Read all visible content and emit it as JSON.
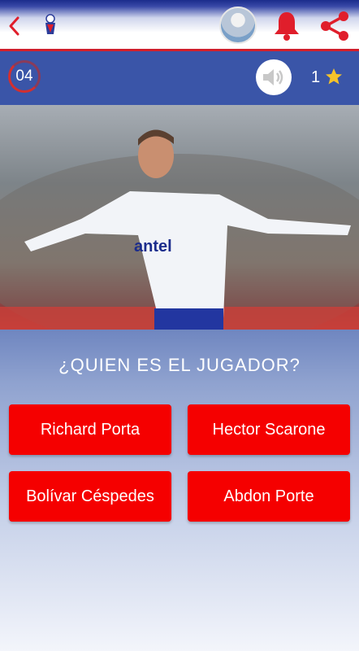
{
  "header": {
    "icons": [
      "back-chevron-icon",
      "team-logo-icon",
      "avatar",
      "bell-icon",
      "share-icon"
    ],
    "colors": {
      "accent_red": "#e01e2b",
      "bar_blue": "#3a55a8"
    }
  },
  "hud": {
    "timer": "04",
    "score": "1",
    "icons": [
      "sound-icon",
      "star-icon"
    ]
  },
  "quiz": {
    "question": "¿QUIEN ES EL JUGADOR?",
    "answers": [
      "Richard Porta",
      "Hector Scarone",
      "Bolívar Céspedes",
      "Abdon Porte"
    ],
    "answer_color": "#f50000"
  }
}
